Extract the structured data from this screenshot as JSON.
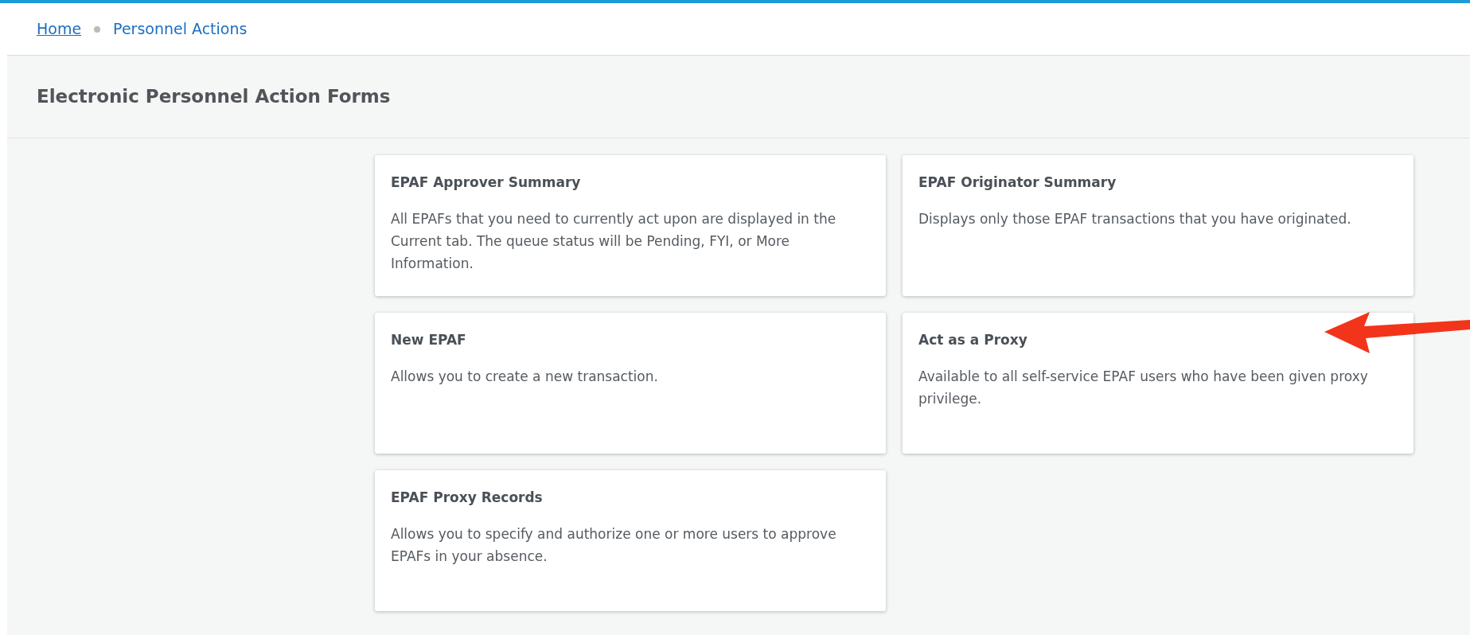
{
  "breadcrumb": [
    {
      "label": "Home",
      "kind": "link"
    },
    {
      "label": "Personnel Actions",
      "kind": "current"
    }
  ],
  "page_title": "Electronic Personnel Action Forms",
  "cards": [
    {
      "title": "EPAF Approver Summary",
      "description": "All EPAFs that you need to currently act upon are displayed in the Current tab. The queue status will be Pending, FYI, or More Information."
    },
    {
      "title": "EPAF Originator Summary",
      "description": "Displays only those EPAF transactions that you have originated."
    },
    {
      "title": "New EPAF",
      "description": "Allows you to create a new transaction."
    },
    {
      "title": "Act as a Proxy",
      "description": "Available to all self-service EPAF users who have been given proxy privilege."
    },
    {
      "title": "EPAF Proxy Records",
      "description": "Allows you to specify and authorize one or more users to approve EPAFs in your absence."
    }
  ]
}
